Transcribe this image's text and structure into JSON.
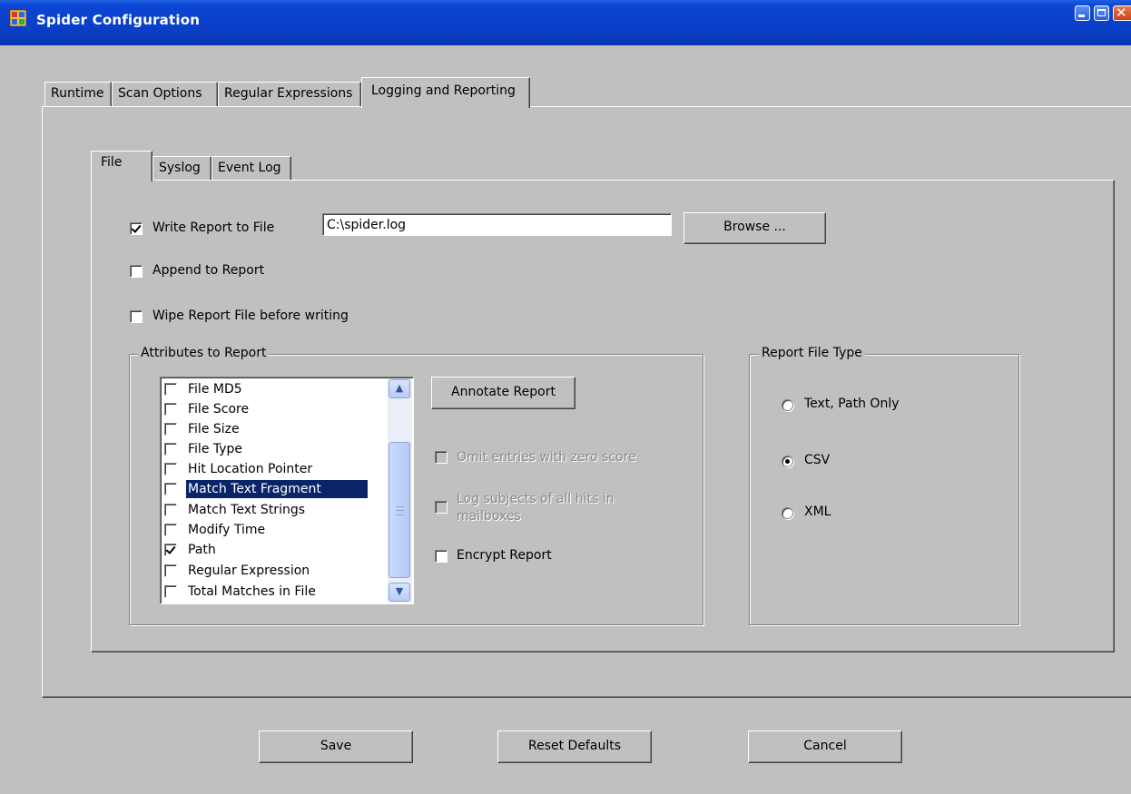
{
  "window": {
    "title": "Spider Configuration",
    "controls": {
      "minimize": "minimize-button",
      "maximize": "maximize-button",
      "close": "close-button"
    }
  },
  "tabs": [
    {
      "label": "Runtime",
      "active": false
    },
    {
      "label": "Scan Options",
      "active": false
    },
    {
      "label": "Regular Expressions",
      "active": false
    },
    {
      "label": "Logging and Reporting",
      "active": true
    }
  ],
  "subtabs": [
    {
      "label": "File",
      "active": true
    },
    {
      "label": "Syslog",
      "active": false
    },
    {
      "label": "Event Log",
      "active": false
    }
  ],
  "file": {
    "write_report": {
      "label": "Write Report to File",
      "checked": true
    },
    "path_value": "C:\\spider.log",
    "browse_label": "Browse ...",
    "append": {
      "label": "Append to Report",
      "checked": false
    },
    "wipe": {
      "label": "Wipe Report File before writing",
      "checked": false
    }
  },
  "attributes": {
    "legend": "Attributes to Report",
    "items": [
      {
        "label": "File MD5",
        "checked": false,
        "selected": false
      },
      {
        "label": "File Score",
        "checked": false,
        "selected": false
      },
      {
        "label": "File Size",
        "checked": false,
        "selected": false
      },
      {
        "label": "File Type",
        "checked": false,
        "selected": false
      },
      {
        "label": "Hit Location Pointer",
        "checked": false,
        "selected": false
      },
      {
        "label": "Match Text Fragment",
        "checked": false,
        "selected": true
      },
      {
        "label": "Match Text Strings",
        "checked": false,
        "selected": false
      },
      {
        "label": "Modify Time",
        "checked": false,
        "selected": false
      },
      {
        "label": "Path",
        "checked": true,
        "selected": false
      },
      {
        "label": "Regular Expression",
        "checked": false,
        "selected": false
      },
      {
        "label": "Total Matches in File",
        "checked": false,
        "selected": false
      }
    ],
    "annotate_label": "Annotate Report",
    "omit_zero": {
      "label": "Omit entries with zero score",
      "checked": false,
      "enabled": false
    },
    "log_subjects": {
      "label_line1": "Log subjects of all hits in",
      "label_line2": "mailboxes",
      "checked": false,
      "enabled": false
    },
    "encrypt": {
      "label": "Encrypt Report",
      "checked": false
    }
  },
  "report_type": {
    "legend": "Report File Type",
    "options": [
      {
        "label": "Text, Path Only",
        "checked": false
      },
      {
        "label": "CSV",
        "checked": true
      },
      {
        "label": "XML",
        "checked": false
      }
    ]
  },
  "footer": {
    "save": "Save",
    "reset": "Reset Defaults",
    "cancel": "Cancel"
  },
  "colors": {
    "titlebar": "#0a3fc8",
    "dialog_bg": "#c0c0c0",
    "selection": "#0a246a"
  }
}
